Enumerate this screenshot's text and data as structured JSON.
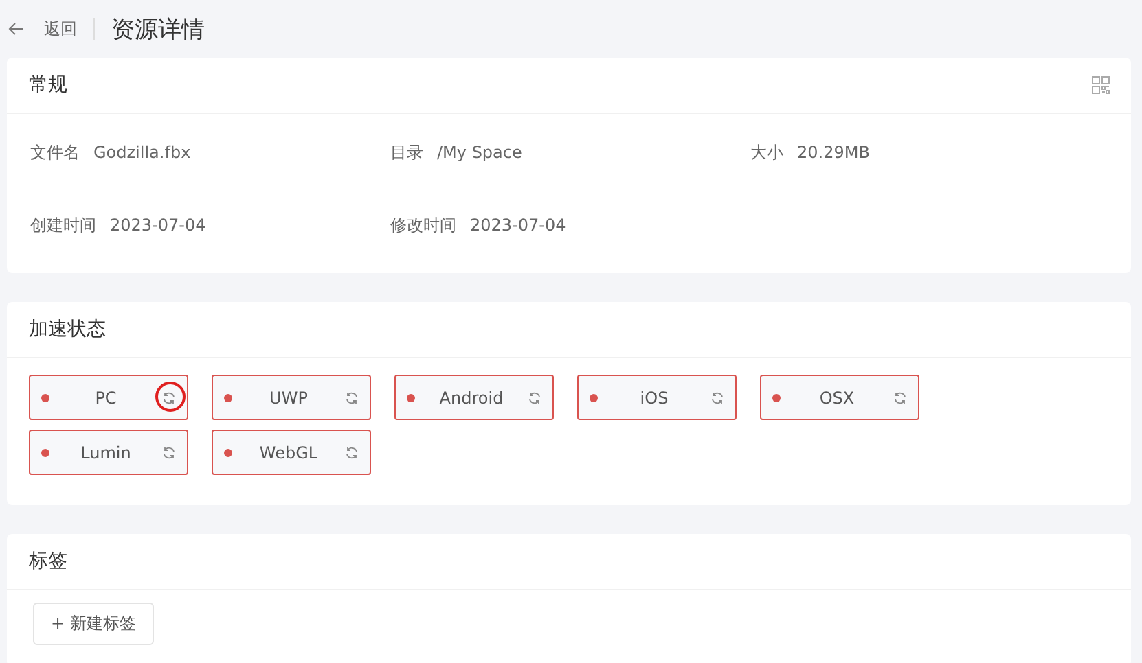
{
  "header": {
    "back": "返回",
    "title": "资源详情"
  },
  "general": {
    "title": "常规",
    "fields": [
      {
        "label": "文件名",
        "value": "Godzilla.fbx"
      },
      {
        "label": "目录",
        "value": "/My Space"
      },
      {
        "label": "大小",
        "value": "20.29MB"
      },
      {
        "label": "创建时间",
        "value": "2023-07-04"
      },
      {
        "label": "修改时间",
        "value": "2023-07-04"
      }
    ]
  },
  "acceleration": {
    "title": "加速状态",
    "platforms": [
      {
        "name": "PC",
        "color": "#d9534f",
        "highlighted": true
      },
      {
        "name": "UWP",
        "color": "#d9534f",
        "highlighted": false
      },
      {
        "name": "Android",
        "color": "#d9534f",
        "highlighted": false
      },
      {
        "name": "iOS",
        "color": "#d9534f",
        "highlighted": false
      },
      {
        "name": "OSX",
        "color": "#d9534f",
        "highlighted": false
      },
      {
        "name": "Lumin",
        "color": "#d9534f",
        "highlighted": false
      },
      {
        "name": "WebGL",
        "color": "#d9534f",
        "highlighted": false
      }
    ]
  },
  "tags": {
    "title": "标签",
    "add_button": "+ 新建标签"
  }
}
